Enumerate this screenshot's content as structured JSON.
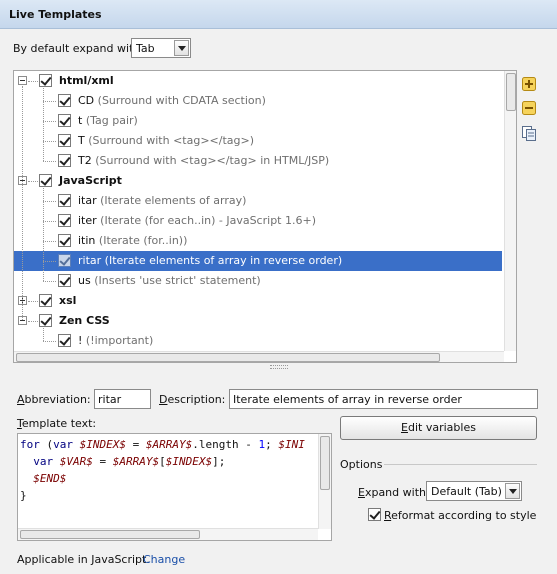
{
  "header": {
    "title": "Live Templates"
  },
  "expand_default": {
    "label": "By default expand with",
    "value": "Tab"
  },
  "tree": {
    "rows": [
      {
        "type": "group",
        "name": "html/xml",
        "desc": "",
        "checked": true,
        "expanded": true
      },
      {
        "type": "item",
        "name": "CD",
        "desc": "(Surround with CDATA section)",
        "checked": true
      },
      {
        "type": "item",
        "name": "t",
        "desc": "(Tag pair)",
        "checked": true
      },
      {
        "type": "item",
        "name": "T",
        "desc": "(Surround with <tag></tag>)",
        "checked": true
      },
      {
        "type": "item",
        "name": "T2",
        "desc": "(Surround with <tag></tag> in HTML/JSP)",
        "checked": true
      },
      {
        "type": "group",
        "name": "JavaScript",
        "desc": "",
        "checked": true,
        "expanded": true
      },
      {
        "type": "item",
        "name": "itar",
        "desc": "(Iterate elements of array)",
        "checked": true
      },
      {
        "type": "item",
        "name": "iter",
        "desc": "(Iterate (for each..in) - JavaScript 1.6+)",
        "checked": true
      },
      {
        "type": "item",
        "name": "itin",
        "desc": "(Iterate (for..in))",
        "checked": true
      },
      {
        "type": "item",
        "name": "ritar",
        "desc": "(Iterate elements of array in reverse order)",
        "checked": true,
        "selected": true
      },
      {
        "type": "item",
        "name": "us",
        "desc": "(Inserts 'use strict' statement)",
        "checked": true
      },
      {
        "type": "group",
        "name": "xsl",
        "desc": "",
        "checked": true,
        "expanded": false
      },
      {
        "type": "group",
        "name": "Zen CSS",
        "desc": "",
        "checked": true,
        "expanded": true
      },
      {
        "type": "item",
        "name": "!",
        "desc": "(!important)",
        "checked": true
      }
    ]
  },
  "side_buttons": {
    "add": "add-icon",
    "remove": "remove-icon",
    "copy": "copy-icon"
  },
  "abbreviation": {
    "label": "Abbreviation:",
    "value": "ritar"
  },
  "description": {
    "label": "Description:",
    "value": "Iterate elements of array in reverse order"
  },
  "template_text": {
    "label": "Template text:",
    "lines": [
      "for (var $INDEX$ = $ARRAY$.length - 1; $INI",
      "  var $VAR$ = $ARRAY$[$INDEX$];",
      "  $END$",
      "}"
    ]
  },
  "edit_variables": {
    "label": "Edit variables"
  },
  "options": {
    "title": "Options",
    "expand_with_label": "Expand with",
    "expand_with_value": "Default (Tab)",
    "reformat_label": "Reformat according to style",
    "reformat_checked": true
  },
  "applicable": {
    "text": "Applicable in JavaScript.",
    "link": "Change"
  },
  "colors": {
    "selection": "#3a6fc8",
    "header": "#c5d7ec",
    "link": "#1a4fa8"
  }
}
